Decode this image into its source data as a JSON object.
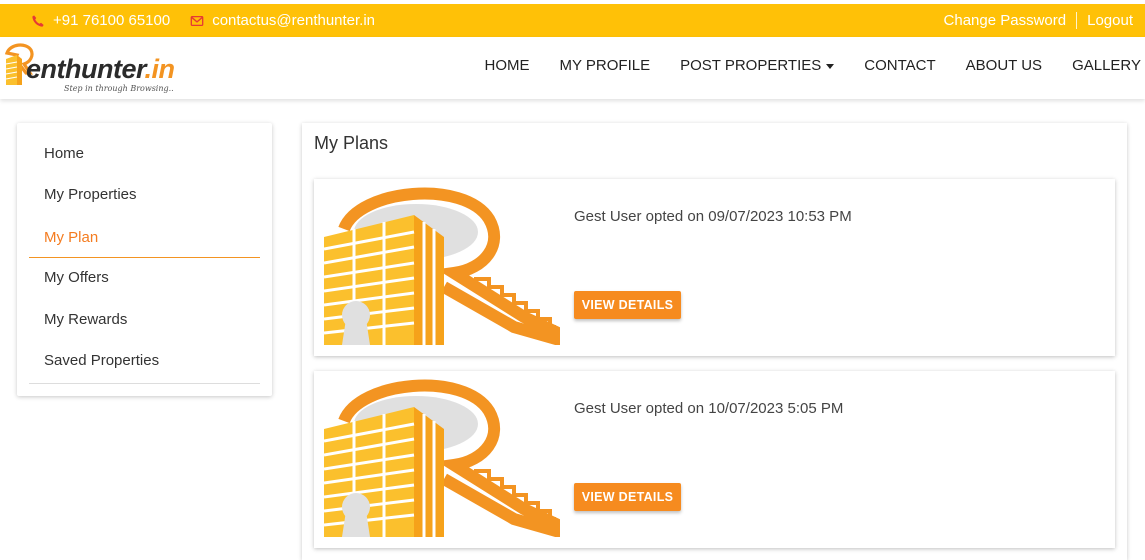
{
  "topbar": {
    "phone": "+91 76100 65100",
    "email": "contactus@renthunter.in",
    "change_password": "Change Password",
    "logout": "Logout"
  },
  "logo": {
    "brand_main": "enthunter",
    "brand_suffix": ".in",
    "tagline": "Step in through Browsing.."
  },
  "nav": {
    "items": [
      "HOME",
      "MY PROFILE",
      "POST PROPERTIES",
      "CONTACT",
      "ABOUT US",
      "GALLERY"
    ]
  },
  "sidebar": {
    "items": [
      "Home",
      "My Properties",
      "My Plan",
      "My Offers",
      "My Rewards",
      "Saved Properties"
    ],
    "active": "My Plan"
  },
  "main": {
    "title": "My Plans",
    "plans": [
      {
        "text": "Gest User opted on 09/07/2023 10:53 PM",
        "button": "VIEW DETAILS"
      },
      {
        "text": "Gest User opted on 10/07/2023 5:05 PM",
        "button": "VIEW DETAILS"
      }
    ]
  },
  "colors": {
    "topbar": "#ffc107",
    "accent": "#f68b1f",
    "building": "#fbc02d"
  },
  "icons": [
    "phone-icon",
    "mail-icon",
    "caret-down-icon"
  ]
}
